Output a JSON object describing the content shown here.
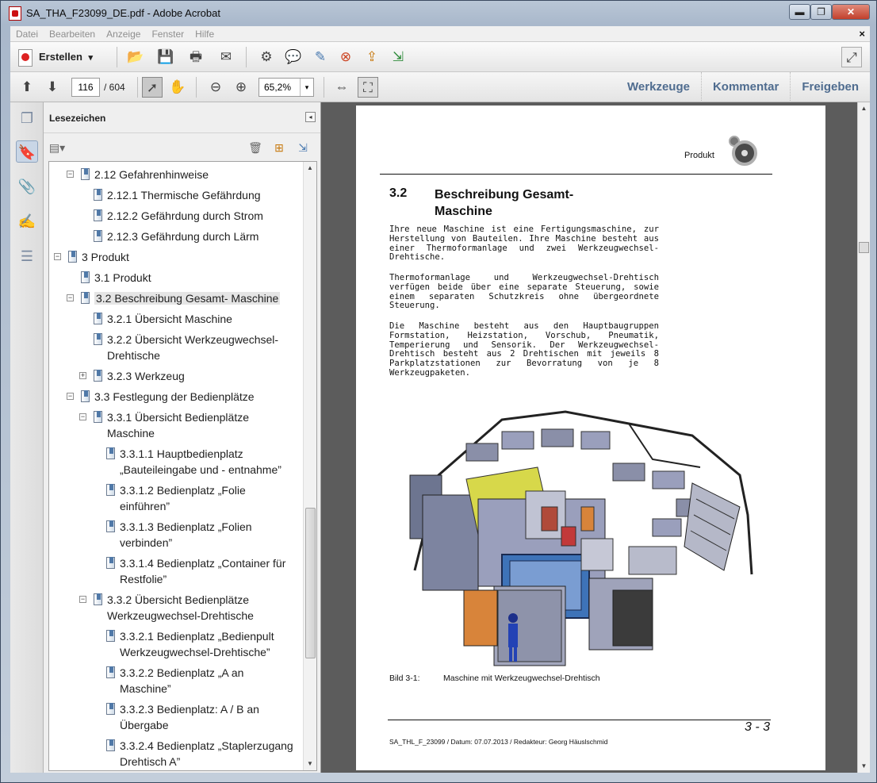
{
  "window": {
    "title": "SA_THA_F23099_DE.pdf - Adobe Acrobat",
    "controls": {
      "minimize": "▬",
      "maximize": "❐",
      "close": "✕"
    }
  },
  "menu": {
    "items": [
      "Datei",
      "Bearbeiten",
      "Anzeige",
      "Fenster",
      "Hilfe"
    ],
    "close": "×"
  },
  "toolbar": {
    "create_label": "Erstellen",
    "create_arrow": "▾"
  },
  "nav": {
    "page_current": "116",
    "page_total": "/  604",
    "zoom": "65,2%",
    "zoom_arrow": "▾",
    "links": [
      "Werkzeuge",
      "Kommentar",
      "Freigeben"
    ]
  },
  "sidepanel": {
    "title": "Lesezeichen",
    "collapse_glyph": "◂"
  },
  "bookmarks": [
    {
      "label": "2.12 Gefahrenhinweise",
      "toggle": "−"
    },
    {
      "label": "2.12.1 Thermische Gefährdung"
    },
    {
      "label": "2.12.2 Gefährdung durch Strom"
    },
    {
      "label": "2.12.3 Gefährdung durch Lärm"
    },
    {
      "label": "3 Produkt",
      "toggle": "−"
    },
    {
      "label": "3.1 Produkt"
    },
    {
      "label": "3.2 Beschreibung Gesamt- Maschine",
      "toggle": "−"
    },
    {
      "label": "3.2.1 Übersicht Maschine"
    },
    {
      "label": "3.2.2 Übersicht Werkzeugwechsel-",
      "label2": "Drehtische"
    },
    {
      "label": "3.2.3 Werkzeug",
      "toggle": "+"
    },
    {
      "label": "3.3 Festlegung der Bedienplätze",
      "toggle": "−"
    },
    {
      "label": "3.3.1 Übersicht Bedienplätze",
      "label2": "Maschine",
      "toggle": "−"
    },
    {
      "label": "3.3.1.1 Hauptbedienplatz",
      "label2": "„Bauteileingabe und - entnahme”"
    },
    {
      "label": "3.3.1.2 Bedienplatz „Folie",
      "label2": "einführen”"
    },
    {
      "label": "3.3.1.3 Bedienplatz „Folien",
      "label2": "verbinden”"
    },
    {
      "label": "3.3.1.4 Bedienplatz „Container für",
      "label2": "Restfolie”"
    },
    {
      "label": "3.3.2 Übersicht Bedienplätze",
      "label2": "Werkzeugwechsel-Drehtische",
      "toggle": "−"
    },
    {
      "label": "3.3.2.1 Bedienplatz „Bedienpult",
      "label2": "Werkzeugwechsel-Drehtische”"
    },
    {
      "label": "3.3.2.2 Bedienplatz „A an",
      "label2": "Maschine”"
    },
    {
      "label": "3.3.2.3 Bedienplatz: A / B an",
      "label2": "Übergabe"
    },
    {
      "label": "3.3.2.4 Bedienplatz „Staplerzugang",
      "label2": "Drehtisch A”"
    }
  ],
  "document": {
    "header": "Produkt",
    "section_number": "3.2",
    "section_title": "Beschreibung Gesamt-Maschine",
    "paragraphs": [
      "Ihre neue Maschine ist eine Fertigungsmaschine, zur Herstellung von Bauteilen. Ihre Maschine besteht aus einer Thermoformanlage und zwei Werkzeugwechsel-Drehtische.",
      "Thermoformanlage und Werkzeugwechsel-Drehtisch verfügen beide über eine separate Steuerung, sowie einem separaten Schutzkreis ohne übergeordnete Steuerung.",
      "Die Maschine besteht aus den Hauptbaugruppen Formstation, Heizstation, Vorschub, Pneumatik, Temperierung und Sensorik. Der Werkzeugwechsel-Drehtisch besteht aus 2 Drehtischen mit jeweils 8 Parkplatzstationen zur Bevorratung von je 8 Werkzeugpaketen."
    ],
    "caption_number": "Bild  3-1:",
    "caption_text": "Maschine mit Werkzeugwechsel-Drehtisch",
    "page_number": "3 - 3",
    "footer": "SA_THL_F_23099 / Datum: 07.07.2013 / Redakteur: Georg Häuslschmid"
  },
  "colors": {
    "link_blue": "#4f6c8f",
    "machine_grey": "#8a8fa8",
    "machine_yellow": "#d7d84a",
    "machine_blue": "#3e73b8",
    "machine_orange": "#d8843a"
  }
}
